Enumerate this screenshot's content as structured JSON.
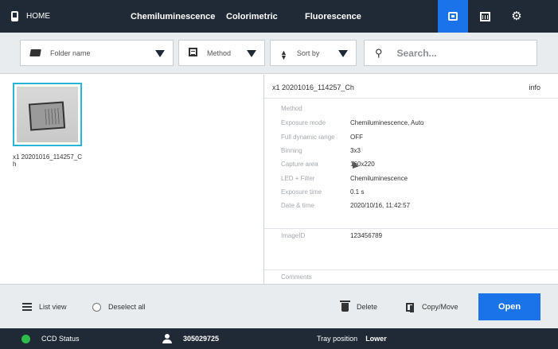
{
  "nav": {
    "home": "HOME",
    "tabs": [
      "Chemiluminescence",
      "Colorimetric",
      "Fluorescence"
    ],
    "icons": [
      "gallery-icon",
      "calendar-icon",
      "gear-icon"
    ],
    "active_icon": "gallery-icon",
    "active_color": "#1a73e8"
  },
  "toolbar": {
    "folder": "Folder name",
    "method": "Method",
    "sort": "Sort by",
    "search_placeholder": "Search..."
  },
  "gallery": {
    "items": [
      {
        "label": "x1 20201016_114257_Ch",
        "selected": true
      }
    ]
  },
  "details": {
    "title": "x1 20201016_114257_Ch",
    "info_label": "info",
    "section_method": "Method",
    "props": [
      {
        "label": "Exposure mode",
        "value": "Chemiluminescence, Auto"
      },
      {
        "label": "Full dynamic range",
        "value": "OFF"
      },
      {
        "label": "Binning",
        "value": "3x3"
      },
      {
        "label": "Capture area",
        "value": "160x220"
      },
      {
        "label": "LED + Filter",
        "value": "Chemiluminescence"
      },
      {
        "label": "Exposure time",
        "value": "0.1 s"
      },
      {
        "label": "Date & time",
        "value": "2020/10/16, 11:42:57"
      }
    ],
    "image_id_label": "ImageID",
    "image_id": "123456789",
    "comments_label": "Comments"
  },
  "actions": {
    "list_view": "List view",
    "deselect_all": "Deselect all",
    "delete": "Delete",
    "copy_move": "Copy/Move",
    "open": "Open"
  },
  "status": {
    "ccd_label": "CCD Status",
    "ccd_color": "#2ebd4a",
    "user_id": "305029725",
    "tray_label": "Tray position",
    "tray_value": "Lower"
  }
}
